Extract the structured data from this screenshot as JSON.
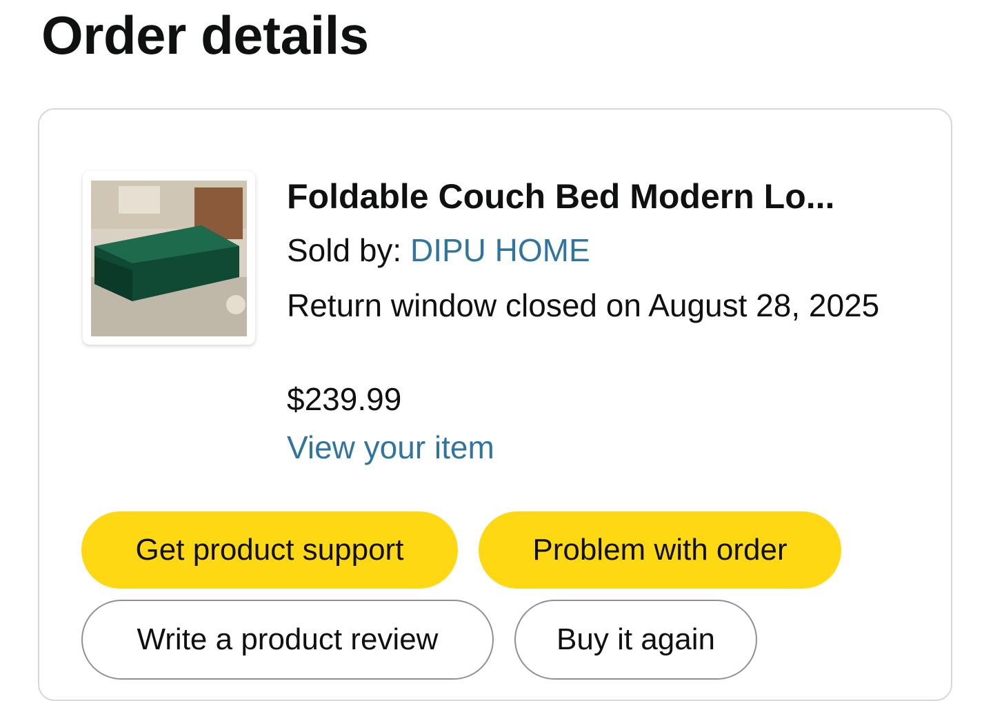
{
  "page": {
    "title": "Order details"
  },
  "order_item": {
    "image_icon": "product-photo-green-couch",
    "title": "Foldable Couch Bed Modern Lo...",
    "sold_by_label": "Sold by: ",
    "seller_name": "DIPU HOME",
    "return_window_text": "Return window closed on August 28, 2025",
    "price": "$239.99",
    "view_item_label": "View your item"
  },
  "actions": {
    "get_support_label": "Get product support",
    "problem_label": "Problem with order",
    "review_label": "Write a product review",
    "buy_again_label": "Buy it again"
  },
  "colors": {
    "primary_button": "#ffd814",
    "link": "#2f75a0",
    "text": "#0f1111",
    "border": "#d5d9d9"
  }
}
